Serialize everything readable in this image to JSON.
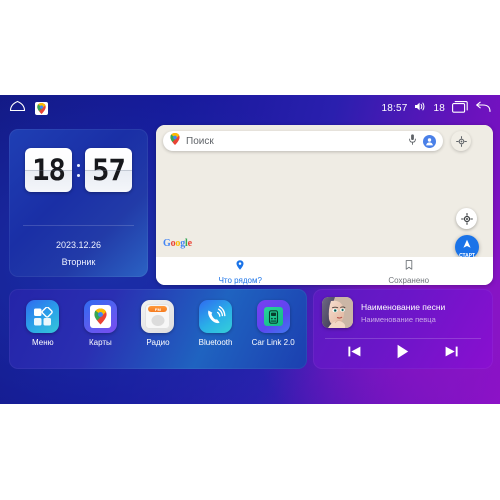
{
  "statusbar": {
    "home_icon": "home-icon",
    "maps_shortcut_icon": "google-maps-app-icon",
    "time": "18:57",
    "volume_icon": "volume-icon",
    "volume_level": "18",
    "recents_icon": "recent-apps-icon",
    "back_icon": "back-arrow-icon"
  },
  "clock_widget": {
    "hours": "18",
    "minutes": "57",
    "date": "2023.12.26",
    "weekday": "Вторник"
  },
  "maps_widget": {
    "search": {
      "placeholder": "Поиск",
      "pin_icon": "maps-pin-icon",
      "mic_icon": "microphone-icon",
      "avatar_icon": "account-avatar-icon"
    },
    "layers_icon": "map-layers-icon",
    "locate_icon": "my-location-icon",
    "start_button": {
      "label": "СТАРТ",
      "icon": "navigation-arrow-icon"
    },
    "watermark": "Google",
    "tabs": [
      {
        "label": "Что рядом?",
        "icon": "location-pin-icon",
        "active": true
      },
      {
        "label": "Сохранено",
        "icon": "bookmark-icon",
        "active": false
      }
    ]
  },
  "dock": {
    "apps": [
      {
        "label": "Меню",
        "icon": "apps-grid-icon"
      },
      {
        "label": "Карты",
        "icon": "google-maps-icon"
      },
      {
        "label": "Радио",
        "icon": "fm-radio-icon",
        "badge": "FM"
      },
      {
        "label": "Bluetooth",
        "icon": "bluetooth-phone-icon"
      },
      {
        "label": "Car Link 2.0",
        "icon": "car-link-icon"
      }
    ]
  },
  "music_widget": {
    "title": "Наименование песни",
    "artist": "Наименование певца",
    "album_art_icon": "album-art",
    "controls": [
      {
        "name": "previous",
        "icon": "skip-previous-icon"
      },
      {
        "name": "play",
        "icon": "play-icon"
      },
      {
        "name": "next",
        "icon": "skip-next-icon"
      }
    ]
  },
  "colors": {
    "accent_blue": "#1a73e8",
    "bg_blue": "#16199a",
    "bg_purple": "#8e0fc9",
    "map_surface": "#efece4",
    "artist_text": "#c9a8e8"
  }
}
